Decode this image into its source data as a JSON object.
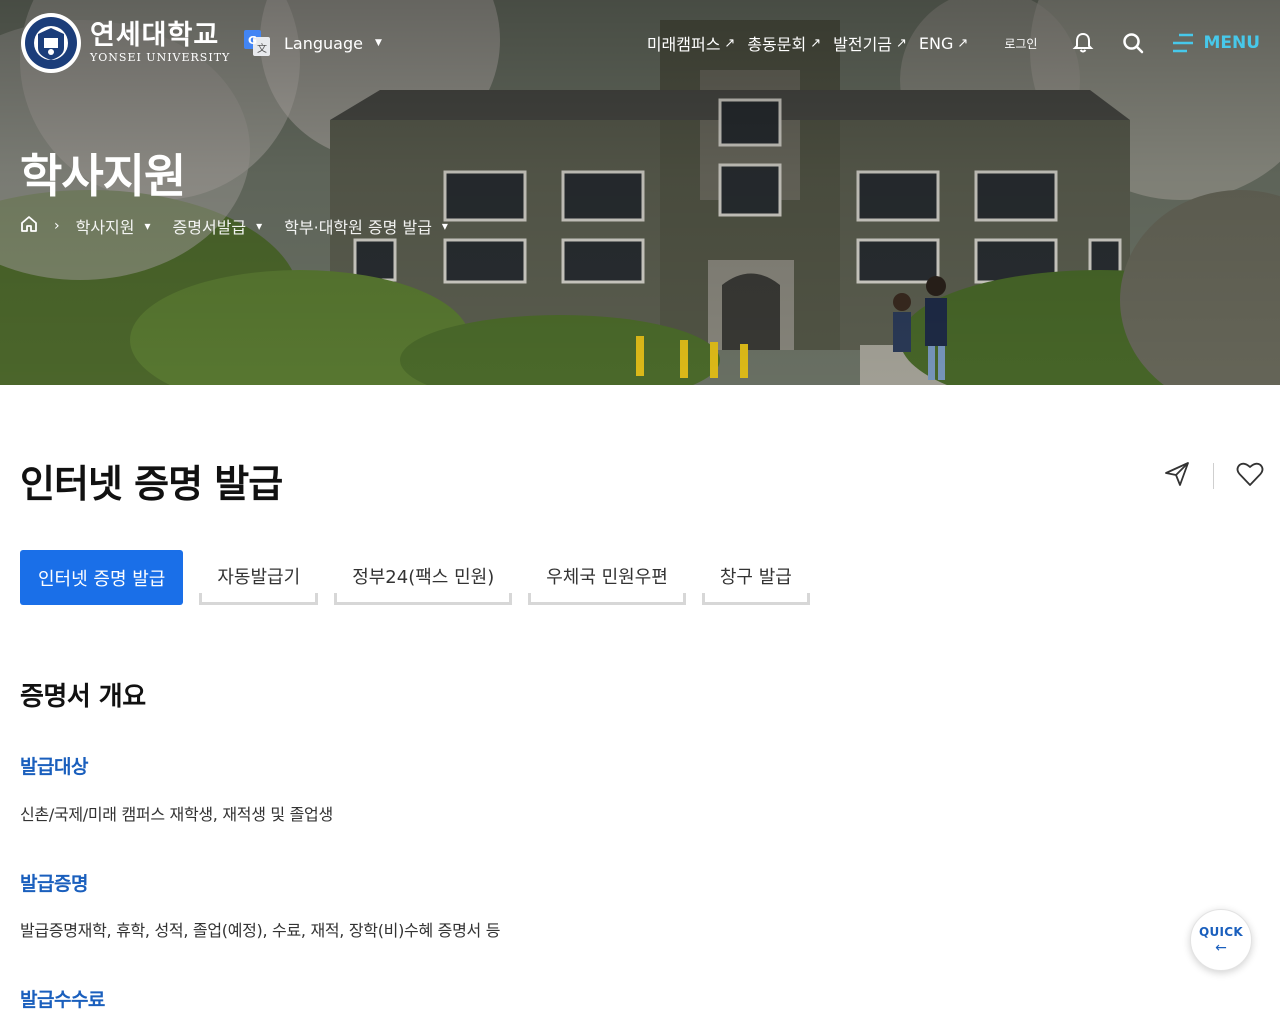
{
  "header": {
    "logo_ko": "연세대학교",
    "logo_en": "YONSEI UNIVERSITY",
    "language_label": "Language",
    "ext_links": [
      {
        "label": "미래캠퍼스"
      },
      {
        "label": "총동문회"
      },
      {
        "label": "발전기금"
      },
      {
        "label": "ENG"
      }
    ],
    "login_label": "로그인",
    "menu_label": "MENU"
  },
  "hero": {
    "title": "학사지원",
    "breadcrumbs": [
      "학사지원",
      "증명서발급",
      "학부·대학원 증명 발급"
    ]
  },
  "page": {
    "title": "인터넷 증명 발급"
  },
  "tabs": [
    {
      "label": "인터넷 증명 발급",
      "active": true
    },
    {
      "label": "자동발급기",
      "active": false
    },
    {
      "label": "정부24(팩스 민원)",
      "active": false
    },
    {
      "label": "우체국 민원우편",
      "active": false
    },
    {
      "label": "창구 발급",
      "active": false
    }
  ],
  "content": {
    "section_title": "증명서 개요",
    "blocks": [
      {
        "heading": "발급대상",
        "text": "신촌/국제/미래 캠퍼스 재학생, 재적생 및 졸업생"
      },
      {
        "heading": "발급증명",
        "text": "발급증명재학, 휴학, 성적, 졸업(예정), 수료, 재적, 장학(비)수혜 증명서 등"
      },
      {
        "heading": "발급수수료",
        "text": ""
      }
    ]
  },
  "quick": {
    "label": "QUICK"
  },
  "colors": {
    "accent": "#1a6fe8",
    "subheading": "#1a5fbd",
    "menu": "#47c8ea"
  }
}
